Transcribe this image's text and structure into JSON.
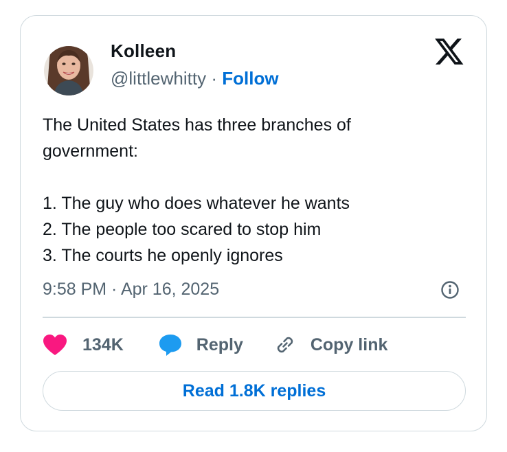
{
  "author": {
    "name": "Kolleen",
    "handle": "@littlewhitty",
    "separator": "·",
    "follow_label": "Follow",
    "avatar_icon": "profile-photo"
  },
  "tweet": {
    "lines": [
      "The United States has three branches of",
      "government:",
      "",
      "1. The guy who does whatever he wants",
      "2. The people too scared to stop him",
      "3. The courts he openly ignores"
    ],
    "timestamp": "9:58 PM · Apr 16, 2025"
  },
  "actions": {
    "like_count": "134K",
    "reply_label": "Reply",
    "copy_link_label": "Copy link"
  },
  "read_replies_label": "Read 1.8K replies",
  "colors": {
    "accent": "#006fd6",
    "like": "#f91880",
    "reply": "#1d9bf0",
    "secondary_text": "#536471",
    "border": "#cfd9de"
  }
}
